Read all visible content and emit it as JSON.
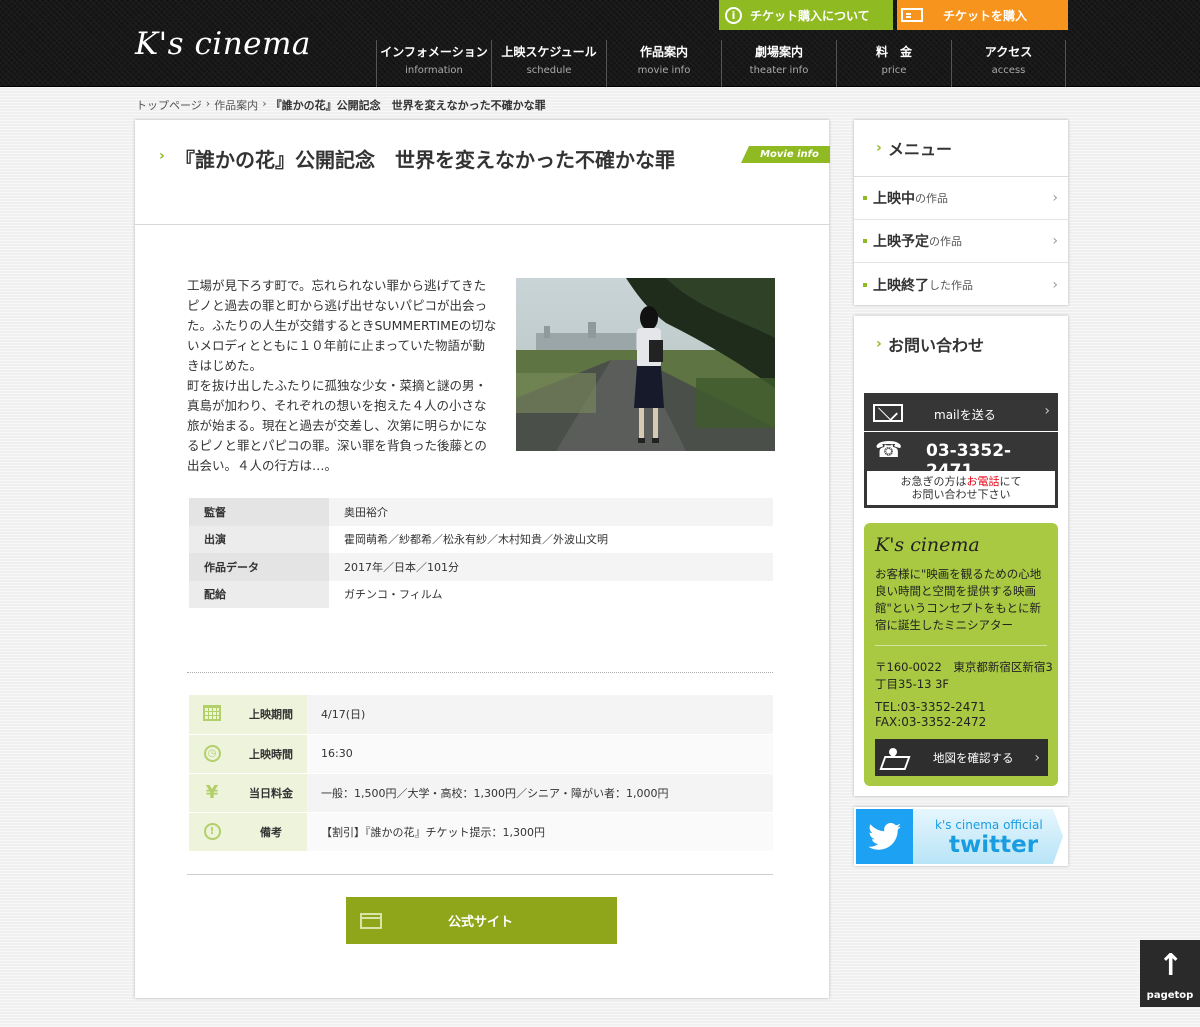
{
  "header": {
    "logo": "K's cinema",
    "ticket_info": "チケット購入について",
    "ticket_buy": "チケットを購入",
    "nav": [
      {
        "jp": "インフォメーション",
        "en": "information"
      },
      {
        "jp": "上映スケジュール",
        "en": "schedule"
      },
      {
        "jp": "作品案内",
        "en": "movie info"
      },
      {
        "jp": "劇場案内",
        "en": "theater info"
      },
      {
        "jp": "料　金",
        "en": "price"
      },
      {
        "jp": "アクセス",
        "en": "access"
      }
    ]
  },
  "breadcrumb": {
    "home": "トップページ",
    "sep": "›",
    "movies": "作品案内",
    "current": "『誰かの花』公開記念　世界を変えなかった不確かな罪"
  },
  "main": {
    "title": "『誰かの花』公開記念　世界を変えなかった不確かな罪",
    "tag": "Movie info",
    "synopsis": "工場が見下ろす町で。忘れられない罪から逃げてきたピノと過去の罪と町から逃げ出せないパピコが出会った。ふたりの人生が交錯するときSUMMERTIMEの切ないメロディとともに１０年前に止まっていた物語が動きはじめた。\n町を抜け出したふたりに孤独な少女・菜摘と謎の男・真島が加わり、それぞれの想いを抱えた４人の小さな旅が始まる。現在と過去が交差し、次第に明らかになるピノと罪とパピコの罪。深い罪を背負った後藤との出会い。４人の行方は…。",
    "credits": [
      {
        "label": "監督",
        "value": "奥田裕介"
      },
      {
        "label": "出演",
        "value": "霍岡萌希／紗都希／松永有紗／木村知貴／外波山文明"
      },
      {
        "label": "作品データ",
        "value": "2017年／日本／101分"
      },
      {
        "label": "配給",
        "value": "ガチンコ・フィルム"
      }
    ],
    "showtimes": [
      {
        "icon": "calendar-icon",
        "label": "上映期間",
        "value": "4/17(日)"
      },
      {
        "icon": "clock-icon",
        "label": "上映時間",
        "value": "16:30"
      },
      {
        "icon": "yen-icon",
        "label": "当日料金",
        "value": "一般：1,500円／大学・高校：1,300円／シニア・障がい者：1,000円"
      },
      {
        "icon": "notice-icon",
        "label": "備考",
        "value": "【割引】『誰かの花』チケット提示：1,300円"
      }
    ],
    "official_site": "公式サイト"
  },
  "sidebar": {
    "menu_title": "メニュー",
    "menu": [
      {
        "strong": "上映中",
        "small": "の作品"
      },
      {
        "strong": "上映予定",
        "small": "の作品"
      },
      {
        "strong": "上映終了",
        "small": "した作品"
      }
    ],
    "contact_title": "お問い合わせ",
    "mail": "mailを送る",
    "tel": "03-3352-2471",
    "note_a": "お急ぎの方は",
    "note_red": "お電話",
    "note_b": "にて",
    "note_c": "お問い合わせ下さい",
    "ks_logo": "K's cinema",
    "ks_desc": "お客様に\"映画を観るための心地良い時間と空間を提供する映画館\"というコンセプトをもとに新宿に誕生したミニシアター",
    "ks_address": "〒160-0022　東京都新宿区新宿3丁目35-13 3F",
    "ks_tel": "TEL:03-3352-2471",
    "ks_fax": "FAX:03-3352-2472",
    "map_button": "地図を確認する",
    "twitter_l1": "k's cinema official",
    "twitter_l2": "twitter"
  },
  "pagetop": "pagetop",
  "colors": {
    "accent_green": "#8fba21",
    "ticket_orange": "#f7941d",
    "twitter_blue": "#1da1f2"
  }
}
